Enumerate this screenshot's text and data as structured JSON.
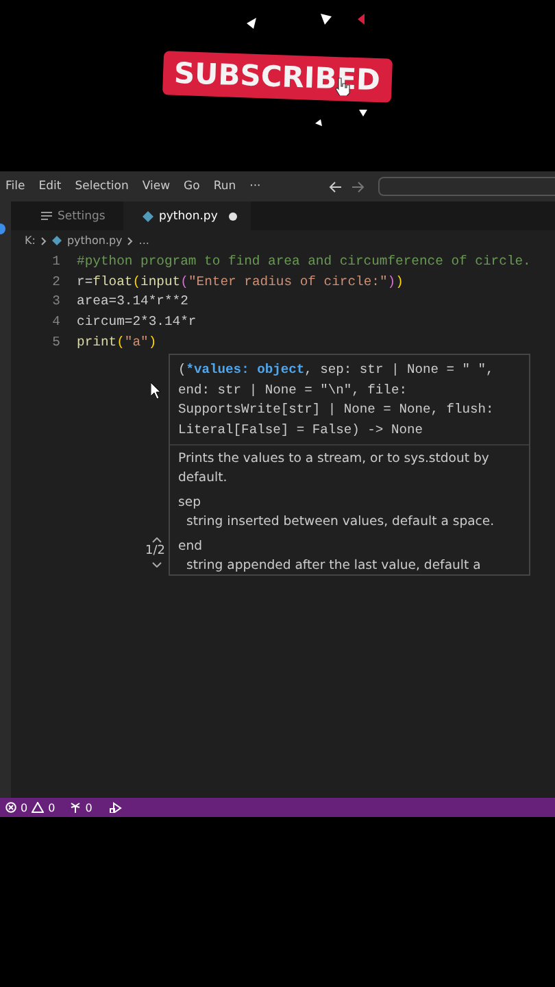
{
  "overlay": {
    "badge": "SUBSCRIBED"
  },
  "menu_bar": {
    "items": [
      "File",
      "Edit",
      "Selection",
      "View",
      "Go",
      "Run",
      "···"
    ]
  },
  "tabs": [
    {
      "label": "Settings",
      "kind": "settings",
      "selected": false,
      "dirty": false
    },
    {
      "label": "python.py",
      "kind": "python",
      "selected": true,
      "dirty": true
    }
  ],
  "breadcrumb": [
    "K:",
    "python.py",
    "..."
  ],
  "editor": {
    "lines": [
      {
        "number": "1",
        "tokens": [
          {
            "text": "#python program to find area and circumference of circle.",
            "kind": "comment"
          }
        ]
      },
      {
        "number": "2",
        "tokens": [
          {
            "text": "r=",
            "kind": "plain"
          },
          {
            "text": "float",
            "kind": "func"
          },
          {
            "text": "(",
            "kind": "bracket"
          },
          {
            "text": "input",
            "kind": "func"
          },
          {
            "text": "(",
            "kind": "bracket2"
          },
          {
            "text": "\"Enter radius of circle:\"",
            "kind": "string"
          },
          {
            "text": ")",
            "kind": "bracket2"
          },
          {
            "text": ")",
            "kind": "bracket"
          }
        ]
      },
      {
        "number": "3",
        "tokens": [
          {
            "text": "area=3.14*r**2",
            "kind": "plain"
          }
        ]
      },
      {
        "number": "4",
        "tokens": [
          {
            "text": "circum=2*3.14*r",
            "kind": "plain"
          }
        ]
      },
      {
        "number": "5",
        "tokens": [
          {
            "text": "print",
            "kind": "func"
          },
          {
            "text": "(",
            "kind": "bracket"
          },
          {
            "text": "\"a\"",
            "kind": "string"
          },
          {
            "text": ")",
            "kind": "bracket"
          }
        ]
      }
    ]
  },
  "hover": {
    "signature": [
      {
        "text": "(",
        "active": false
      },
      {
        "text": "*values: object",
        "active": true
      },
      {
        "text": ", sep: str | None = \" \",\nend: str | None = \"\\n\", file:\nSupportsWrite[str] | None = None, flush:\nLiteral[False] = False) -> None",
        "active": false
      }
    ],
    "description": "Prints the values to a stream, or to sys.stdout by default.",
    "params": [
      {
        "name": "sep",
        "text": "string inserted between values, default a space."
      },
      {
        "name": "end",
        "text": "string appended after the last value, default a"
      }
    ],
    "counter": "1/2"
  },
  "status_bar": {
    "errors": "0",
    "warnings": "0",
    "ports": "0"
  }
}
